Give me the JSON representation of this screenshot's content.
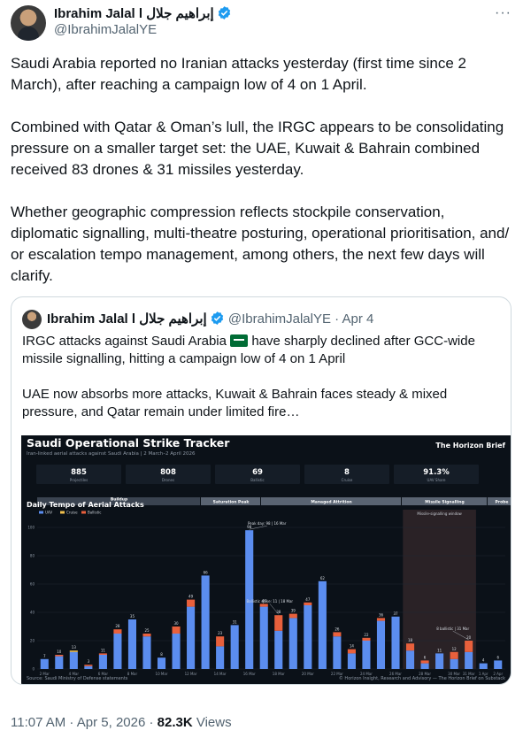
{
  "author": {
    "name": "Ibrahim Jalal l إبراهيم جلال",
    "handle": "@IbrahimJalalYE"
  },
  "more_label": "···",
  "tweet": {
    "p1": "Saudi Arabia reported no Iranian attacks yesterday (first time since 2 March), after reaching a campaign low of 4 on 1 April.",
    "p2": "Combined with Qatar & Oman’s lull, the IRGC appears to be consolidating pressure on a smaller target set: the UAE, Kuwait & Bahrain combined received 83 drones & 31 missiles yesterday.",
    "p3": "Whether geographic compression reflects stockpile conservation, diplomatic signalling, multi-theatre posturing, operational prioritisation, and/ or escalation tempo management, among others, the next few days will clarify."
  },
  "quote": {
    "name": "Ibrahim Jalal l إبراهيم جلال",
    "handle": "@IbrahimJalalYE",
    "date": "· Apr 4",
    "p1a": "IRGC attacks against Saudi Arabia",
    "p1b": "have sharply declined after GCC-wide missile signalling, hitting a campaign low of 4 on 1 April",
    "p2": "UAE now absorbs more attacks, Kuwait & Bahrain faces steady & mixed pressure, and Qatar remain under limited fire…"
  },
  "card": {
    "title": "Saudi Operational Strike Tracker",
    "subtitle": "Iran-linked aerial attacks against Saudi Arabia | 2 March–2 April 2026",
    "brand": "The Horizon Brief",
    "stats": [
      {
        "value": "885",
        "label": "Projectiles"
      },
      {
        "value": "808",
        "label": "Drones"
      },
      {
        "value": "69",
        "label": "Ballistic"
      },
      {
        "value": "8",
        "label": "Cruise"
      },
      {
        "value": "91.3%",
        "label": "UAV Share"
      }
    ],
    "phases": [
      "Buildup",
      "Saturation Peak",
      "Managed Attrition",
      "Missile Signalling",
      "Probe"
    ],
    "window_label": "Missile-signalling window",
    "source": "Source: Saudi Ministry of Defense statements",
    "credit": "© Horizon Insight, Research and Advisory — The Horizon Brief on Substack",
    "annotations": [
      "Peak day: 98 | 16 Mar",
      "Ballistic spike: 11 | 18 Mar",
      "8 ballistic | 31 Mar"
    ]
  },
  "chart_data": {
    "type": "bar",
    "title": "Daily Tempo of Aerial Attacks",
    "stacked": true,
    "colors": {
      "UAV": "#5b8def",
      "Cruise": "#f2c14e",
      "Ballistic": "#e8603c"
    },
    "ylim": [
      0,
      100
    ],
    "yticks": [
      0,
      20,
      40,
      60,
      80,
      100
    ],
    "xtick_labels": [
      "2 Mar",
      "4 Mar",
      "6 Mar",
      "8 Mar",
      "10 Mar",
      "12 Mar",
      "14 Mar",
      "16 Mar",
      "18 Mar",
      "20 Mar",
      "22 Mar",
      "24 Mar",
      "26 Mar",
      "28 Mar",
      "30 Mar",
      "31 Mar",
      "1 Apr",
      "2 Apr"
    ],
    "categories": [
      "2 Mar",
      "3 Mar",
      "4 Mar",
      "5 Mar",
      "6 Mar",
      "7 Mar",
      "8 Mar",
      "9 Mar",
      "10 Mar",
      "11 Mar",
      "12 Mar",
      "13 Mar",
      "14 Mar",
      "15 Mar",
      "16 Mar",
      "17 Mar",
      "18 Mar",
      "19 Mar",
      "20 Mar",
      "21 Mar",
      "22 Mar",
      "23 Mar",
      "24 Mar",
      "25 Mar",
      "26 Mar",
      "27 Mar",
      "28 Mar",
      "29 Mar",
      "30 Mar",
      "31 Mar",
      "1 Apr",
      "2 Apr"
    ],
    "totals": [
      7,
      10,
      13,
      3,
      11,
      28,
      35,
      25,
      8,
      30,
      49,
      66,
      23,
      31,
      98,
      46,
      38,
      39,
      47,
      62,
      26,
      14,
      22,
      36,
      37,
      18,
      6,
      11,
      12,
      20,
      4,
      6
    ],
    "series": [
      {
        "name": "UAV",
        "values": [
          7,
          9,
          12,
          2,
          10,
          25,
          35,
          23,
          8,
          25,
          44,
          66,
          16,
          31,
          98,
          44,
          27,
          36,
          45,
          62,
          23,
          11,
          20,
          34,
          37,
          13,
          4,
          11,
          7,
          12,
          4,
          6
        ]
      },
      {
        "name": "Cruise",
        "values": [
          0,
          0,
          1,
          0,
          0,
          0,
          0,
          0,
          0,
          0,
          0,
          0,
          0,
          0,
          0,
          0,
          0,
          0,
          0,
          0,
          0,
          0,
          0,
          0,
          0,
          0,
          0,
          0,
          0,
          0,
          0,
          0
        ]
      },
      {
        "name": "Ballistic",
        "values": [
          0,
          1,
          0,
          1,
          1,
          3,
          0,
          2,
          0,
          5,
          5,
          0,
          7,
          0,
          0,
          2,
          11,
          3,
          2,
          0,
          3,
          3,
          2,
          2,
          0,
          5,
          2,
          0,
          5,
          8,
          0,
          0
        ]
      }
    ]
  },
  "footer": {
    "time": "11:07 AM · Apr 5, 2026 · ",
    "views": "82.3K",
    "views_label": " Views"
  }
}
